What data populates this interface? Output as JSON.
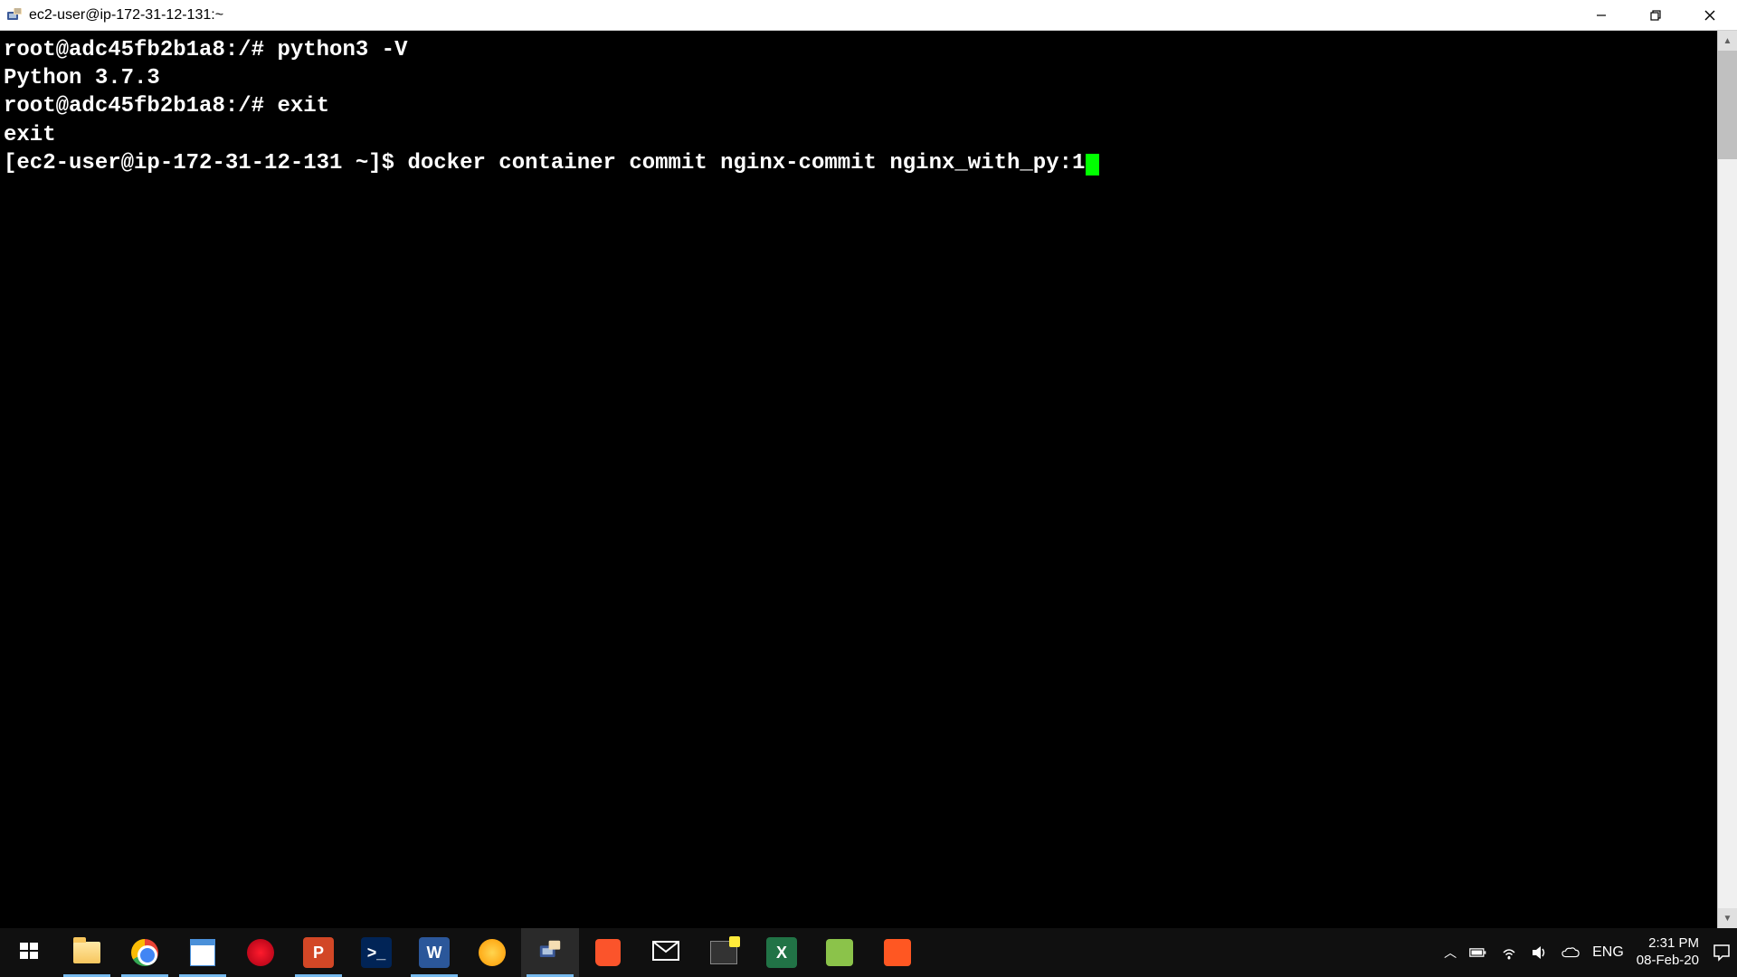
{
  "window": {
    "title": "ec2-user@ip-172-31-12-131:~"
  },
  "terminal": {
    "lines": [
      {
        "prompt": "root@adc45fb2b1a8:/# ",
        "cmd": "python3 -V"
      },
      {
        "plain": "Python 3.7.3"
      },
      {
        "prompt": "root@adc45fb2b1a8:/# ",
        "cmd": "exit"
      },
      {
        "plain": "exit"
      },
      {
        "prompt": "[ec2-user@ip-172-31-12-131 ~]$ ",
        "cmd": "docker container commit nginx-commit nginx_with_py:1",
        "cursor": true
      }
    ]
  },
  "taskbar": {
    "ppt_label": "P",
    "ps_label": ">_",
    "word_label": "W",
    "excel_label": "X",
    "lang": "ENG",
    "time": "2:31 PM",
    "date": "08-Feb-20"
  }
}
